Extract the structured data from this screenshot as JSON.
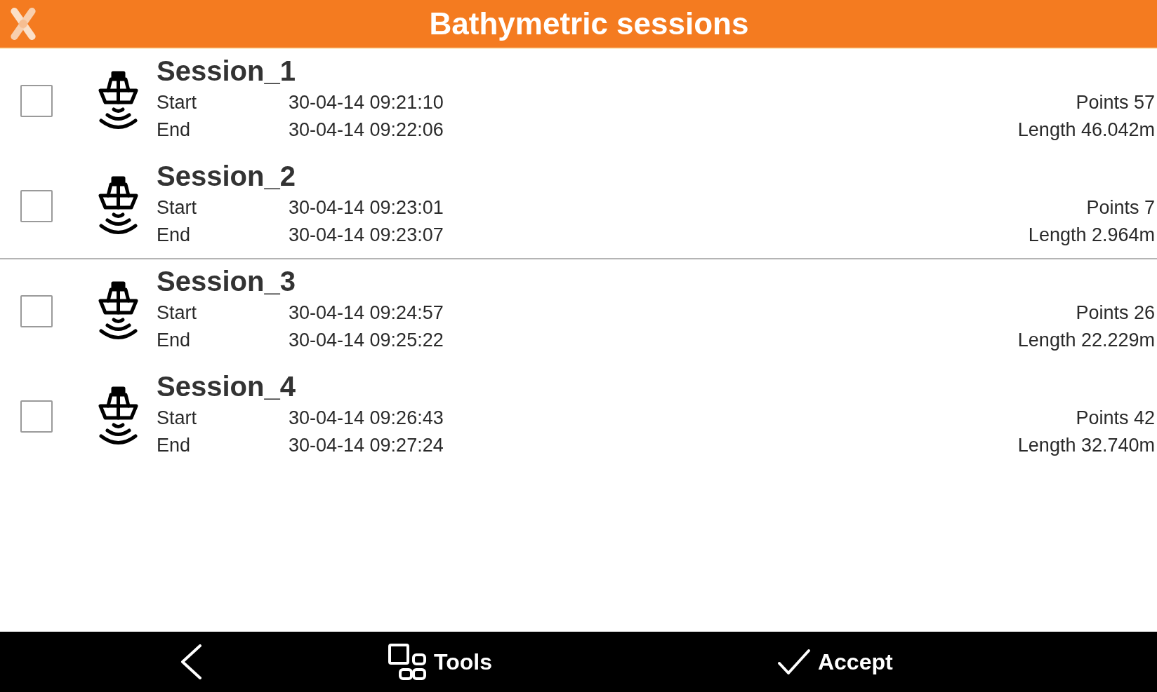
{
  "header": {
    "title": "Bathymetric sessions"
  },
  "sessions": [
    {
      "name": "Session_1",
      "checked": false,
      "start_label": "Start",
      "start": "30-04-14 09:21:10",
      "end_label": "End",
      "end": "30-04-14 09:22:06",
      "points": "Points 57",
      "length": "Length 46.042m",
      "divider_below": false
    },
    {
      "name": "Session_2",
      "checked": false,
      "start_label": "Start",
      "start": "30-04-14 09:23:01",
      "end_label": "End",
      "end": "30-04-14 09:23:07",
      "points": "Points 7",
      "length": "Length 2.964m",
      "divider_below": true
    },
    {
      "name": "Session_3",
      "checked": false,
      "start_label": "Start",
      "start": "30-04-14 09:24:57",
      "end_label": "End",
      "end": "30-04-14 09:25:22",
      "points": "Points 26",
      "length": "Length 22.229m",
      "divider_below": false
    },
    {
      "name": "Session_4",
      "checked": false,
      "start_label": "Start",
      "start": "30-04-14 09:26:43",
      "end_label": "End",
      "end": "30-04-14 09:27:24",
      "points": "Points 42",
      "length": "Length 32.740m",
      "divider_below": false
    }
  ],
  "toolbar": {
    "buttons": [
      {
        "kind": "back"
      },
      {
        "kind": "tools",
        "label": "Tools"
      },
      {
        "kind": "accept",
        "label": "Accept"
      }
    ]
  }
}
